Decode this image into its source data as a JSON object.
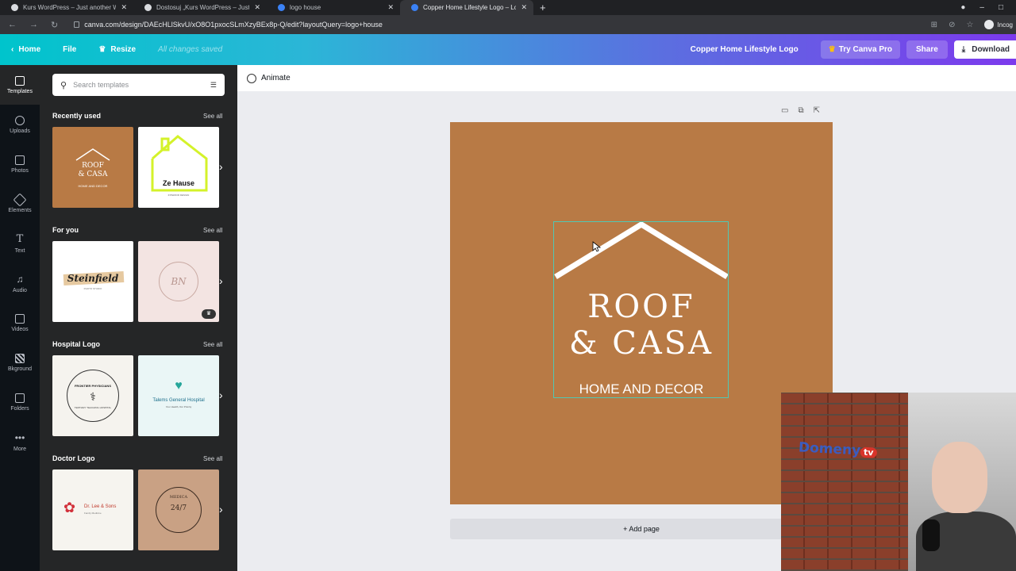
{
  "browser": {
    "tabs": [
      {
        "title": "Kurs WordPress – Just another W"
      },
      {
        "title": "Dostosuj „Kurs WordPress – Just"
      },
      {
        "title": "logo house"
      },
      {
        "title": "Copper Home Lifestyle Logo – Lo"
      }
    ],
    "url": "canva.com/design/DAEcHLlSkvU/xO8O1pxocSLmXzyBEx8p-Q/edit?layoutQuery=logo+house",
    "profile": "Incog"
  },
  "header": {
    "home": "Home",
    "file": "File",
    "resize": "Resize",
    "status": "All changes saved",
    "design_title": "Copper Home Lifestyle Logo",
    "try_pro": "Try Canva Pro",
    "share": "Share",
    "download": "Download"
  },
  "rail": [
    {
      "label": "Templates"
    },
    {
      "label": "Uploads"
    },
    {
      "label": "Photos"
    },
    {
      "label": "Elements"
    },
    {
      "label": "Text"
    },
    {
      "label": "Audio"
    },
    {
      "label": "Videos"
    },
    {
      "label": "Bkground"
    },
    {
      "label": "Folders"
    },
    {
      "label": "More"
    }
  ],
  "panel": {
    "search_placeholder": "Search templates",
    "see_all": "See all",
    "sections": [
      {
        "title": "Recently used"
      },
      {
        "title": "For you"
      },
      {
        "title": "Hospital Logo"
      },
      {
        "title": "Doctor Logo"
      }
    ],
    "thumbs": {
      "roof_casa_line1": "ROOF",
      "roof_casa_line2": "& CASA",
      "roof_casa_sub": "HOME AND DECOR",
      "ze_hause": "Ze Hause",
      "ze_hause_sub": "INTERIOR DESIGN",
      "steinfield": "Steinfield",
      "steinfield_sub": "PHOTO STUDIO",
      "bn": "BN",
      "frontier": "FRONTIER PHYSICIANS",
      "frontier_sub": "TERTIARY TEACHING HOSPITAL",
      "talems": "Talems General Hospital",
      "talems_sub": "Your Health, Our Priority",
      "drlee": "Dr. Lee & Sons",
      "drlee_sub": "Family Medicine",
      "medica": "MEDICA",
      "medica_sub": "24/7"
    }
  },
  "canvas": {
    "animate": "Animate",
    "logo_line1": "ROOF",
    "logo_line2": "& CASA",
    "logo_sub": "HOME AND DECOR",
    "add_page": "+ Add page",
    "bg_color": "#b87a45"
  },
  "webcam": {
    "brand": "Domeny",
    "brand_badge": "tv"
  }
}
